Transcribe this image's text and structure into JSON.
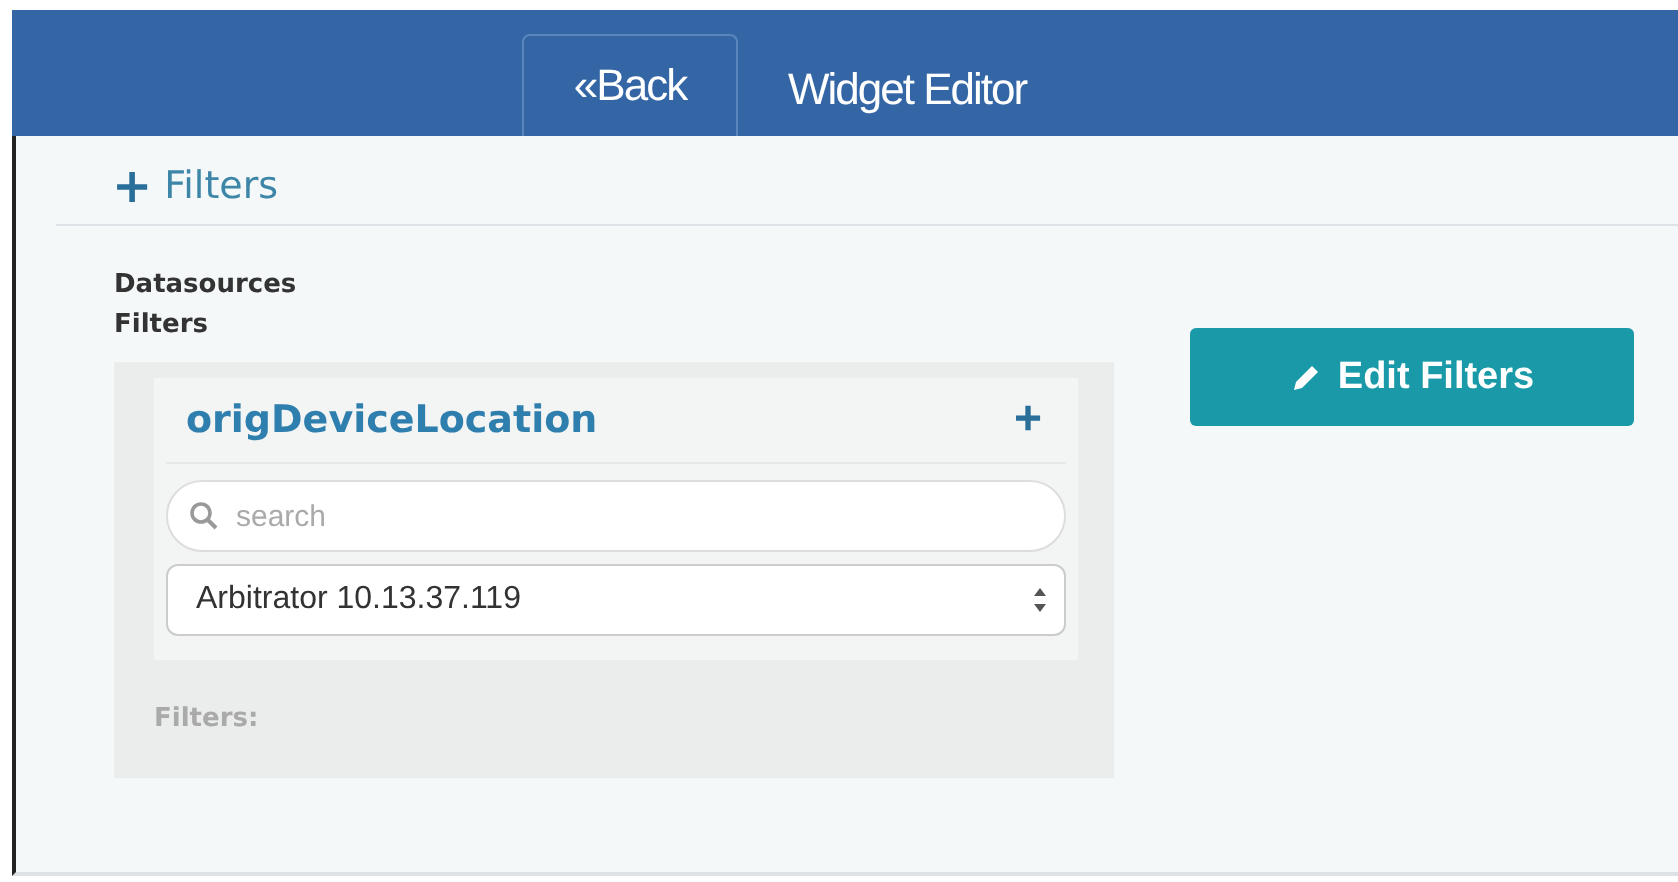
{
  "header": {
    "back_button": "«Back",
    "title": "Widget Editor"
  },
  "section": {
    "toggle": "+",
    "title": "Filters"
  },
  "datasources": {
    "heading": "Datasources",
    "subheading": "Filters"
  },
  "filter_card": {
    "field": "origDeviceLocation",
    "add": "+",
    "search": {
      "placeholder": "search"
    },
    "select": {
      "value": "Arbitrator 10.13.37.119"
    },
    "filters_label": "Filters:"
  },
  "edit_button": "Edit Filters"
}
